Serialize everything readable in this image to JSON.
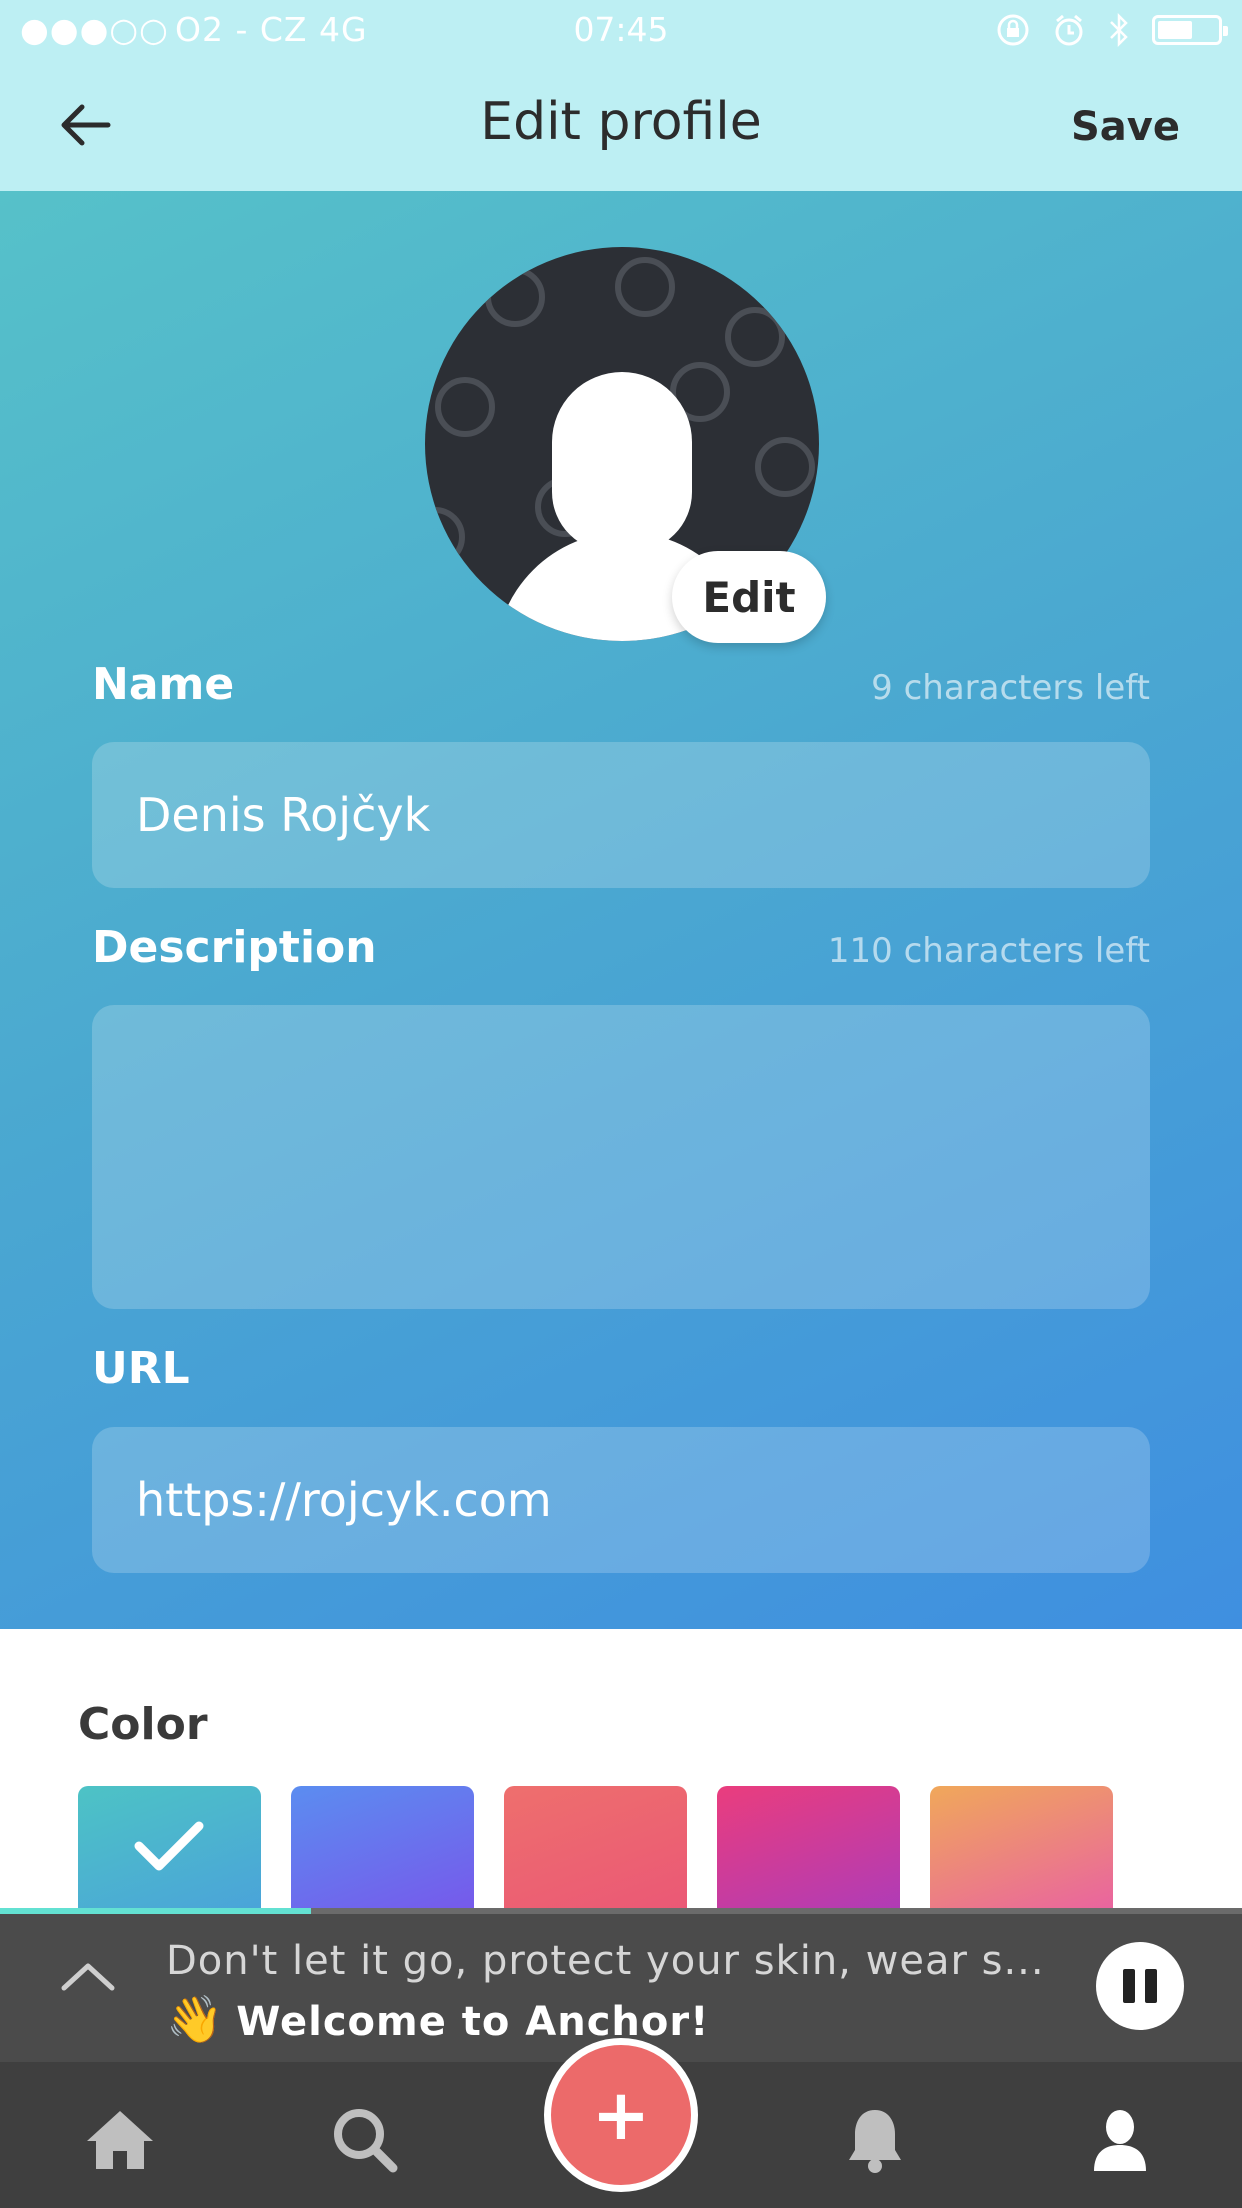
{
  "status_bar": {
    "carrier": "O2 - CZ  4G",
    "signal_dots": "●●●○○",
    "time": "07:45"
  },
  "header": {
    "title": "Edit profile",
    "save_label": "Save",
    "back_icon": "back-arrow-icon"
  },
  "avatar": {
    "edit_label": "Edit",
    "icon": "default-avatar-icon"
  },
  "form": {
    "name": {
      "label": "Name",
      "hint": "9 characters left",
      "value": "Denis Rojčyk"
    },
    "description": {
      "label": "Description",
      "hint": "110 characters left",
      "value": ""
    },
    "url": {
      "label": "URL",
      "value": "https://rojcyk.com"
    }
  },
  "color": {
    "label": "Color",
    "swatches": [
      {
        "name": "teal-blue",
        "from": "#4dc3c5",
        "to": "#4a9fdc",
        "selected": true
      },
      {
        "name": "blue-purple",
        "from": "#5b8df0",
        "to": "#7a52ea",
        "selected": false
      },
      {
        "name": "coral",
        "from": "#ee6f6d",
        "to": "#ea5577",
        "selected": false
      },
      {
        "name": "pink-purple",
        "from": "#ea3d7d",
        "to": "#a73bbf",
        "selected": false
      },
      {
        "name": "orange-pink",
        "from": "#f0a85a",
        "to": "#e85aa9",
        "selected": false
      }
    ]
  },
  "player": {
    "track_text": "Don't let it go, protect your skin, wear s...",
    "episode_text": "Welcome to Anchor!",
    "wave_emoji": "👋",
    "progress_fraction": 0.25
  },
  "tabbar": {
    "tabs": [
      "home-icon",
      "search-icon",
      "create-icon",
      "notifications-icon",
      "profile-icon"
    ],
    "create_symbol": "+"
  },
  "colors": {
    "header_bg": "#bdeff3",
    "accent_record": "#ec6a6a",
    "player_bg": "#4b4b4b",
    "tabbar_bg": "#3f3f3f"
  }
}
